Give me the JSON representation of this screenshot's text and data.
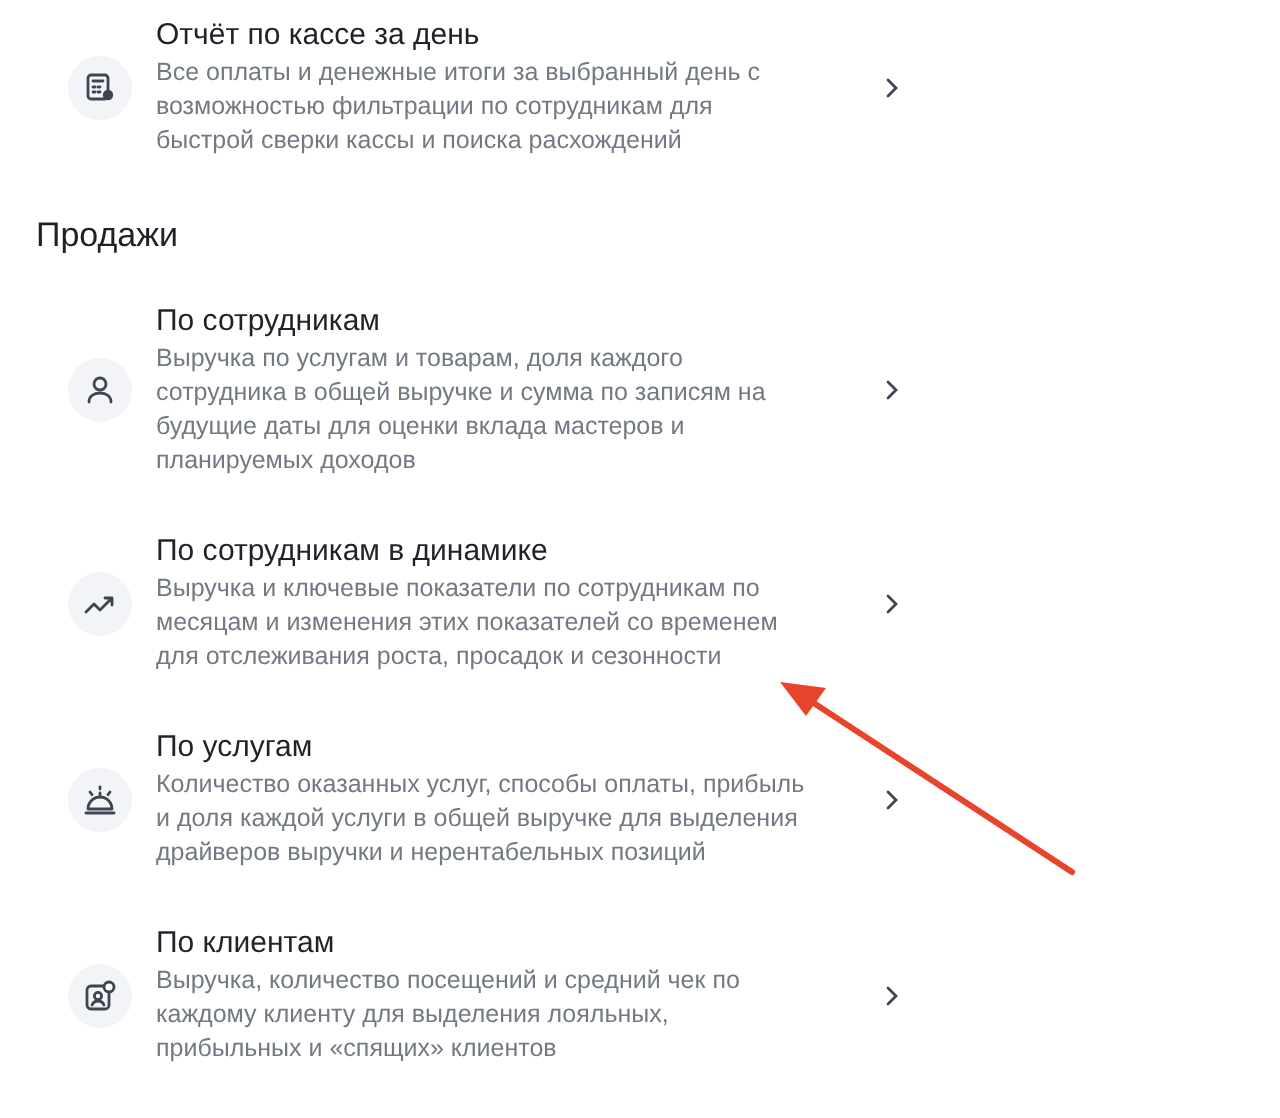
{
  "top_items": [
    {
      "title": "Отчёт по кассе за день",
      "description": "Все оплаты и денежные итоги за выбранный день с возможностью фильтрации по сотрудникам для быстрой сверки кассы и поиска расхождений"
    }
  ],
  "sections": [
    {
      "heading": "Продажи",
      "items": [
        {
          "title": "По сотрудникам",
          "description": "Выручка по услугам и товарам, доля каждого сотрудника в общей выручке и сумма по записям на будущие даты для оценки вклада мастеров и планируемых доходов"
        },
        {
          "title": "По сотрудникам в динамике",
          "description": "Выручка и ключевые показатели по сотрудникам по месяцам и изменения этих показателей со временем для отслеживания роста, просадок и сезонности"
        },
        {
          "title": "По услугам",
          "description": "Количество оказанных услуг, способы оплаты, прибыль и доля каждой услуги в общей выручке для выделения драйверов выручки и нерентабельных позиций"
        },
        {
          "title": "По клиентам",
          "description": "Выручка, количество посещений и средний чек по каждому клиенту для выделения лояльных, прибыльных и «спящих» клиентов"
        }
      ]
    }
  ]
}
